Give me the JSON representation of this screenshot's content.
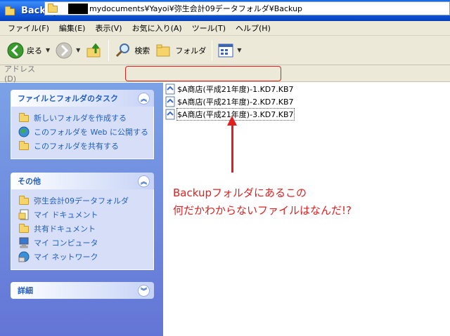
{
  "window": {
    "title": "Backup"
  },
  "menu": [
    "ファイル(F)",
    "編集(E)",
    "表示(V)",
    "お気に入り(A)",
    "ツール(T)",
    "ヘルプ(H)"
  ],
  "toolbar": {
    "back": "戻る",
    "search": "検索",
    "folders": "フォルダ"
  },
  "address": {
    "label": "アドレス(D)",
    "prefix": "mydocuments¥",
    "highlighted": "Yayoi¥弥生会計09データフォルダ¥Backup"
  },
  "tasks_panel": {
    "title": "ファイルとフォルダのタスク",
    "items": [
      "新しいフォルダを作成する",
      "このフォルダを Web に公開する",
      "このフォルダを共有する"
    ]
  },
  "other_panel": {
    "title": "その他",
    "items": [
      "弥生会計09データフォルダ",
      "マイ ドキュメント",
      "共有ドキュメント",
      "マイ コンピュータ",
      "マイ ネットワーク"
    ]
  },
  "details_panel": {
    "title": "詳細"
  },
  "files": [
    "$A商店(平成21年度)-1.KD7.KB7",
    "$A商店(平成21年度)-2.KD7.KB7",
    "$A商店(平成21年度)-3.KD7.KB7"
  ],
  "annotation": {
    "line1": "Backupフォルダにあるこの",
    "line2": "何だかわからないファイルはなんだ!?",
    "color": "#e02020"
  },
  "colors": {
    "titlebar": "#0b4fd3",
    "taskpane": "#6375d6",
    "task_text": "#215dc6"
  }
}
